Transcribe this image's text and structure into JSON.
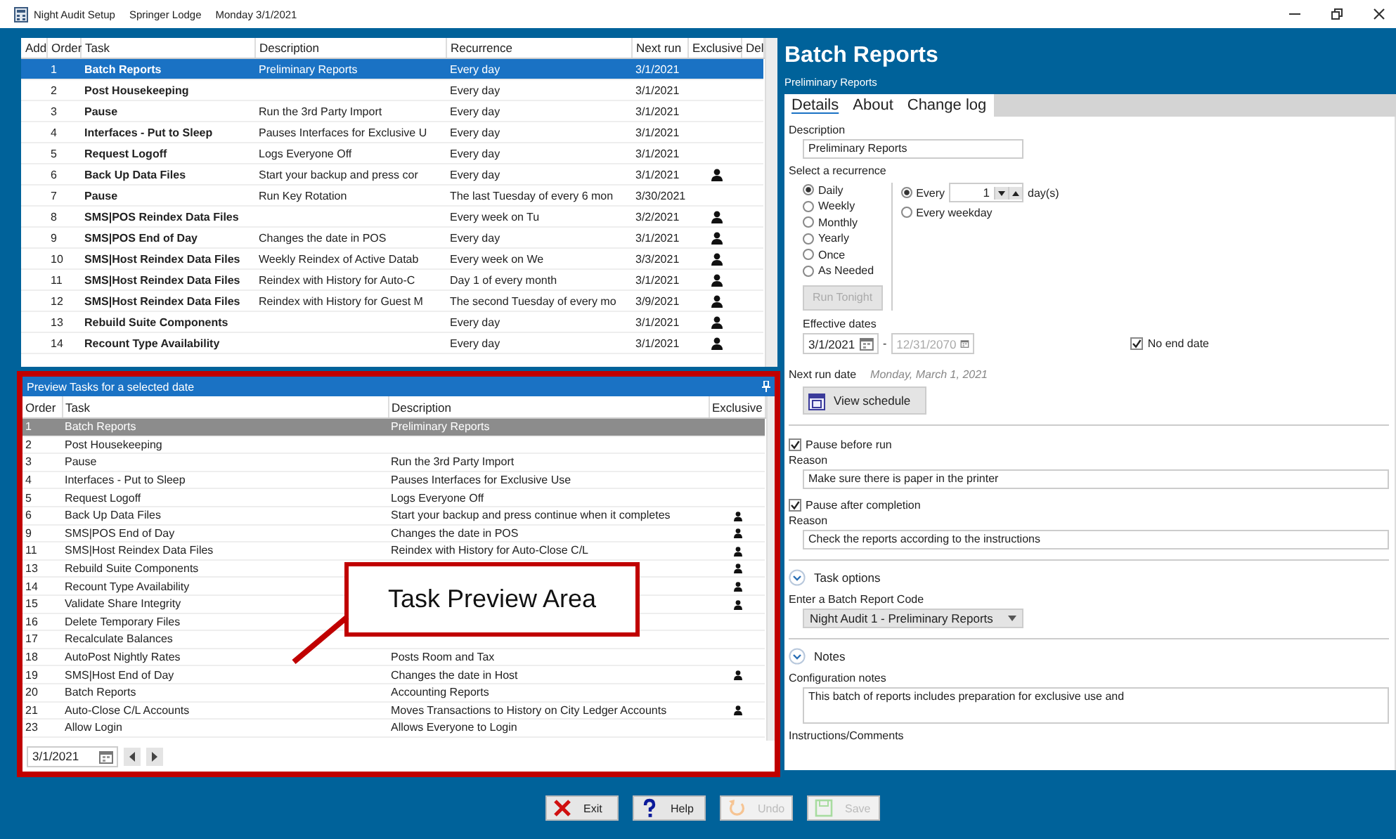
{
  "title_bar": {
    "app_name": "Night Audit Setup",
    "property": "Springer Lodge",
    "date": "Monday 3/1/2021"
  },
  "task_table": {
    "columns": [
      "Add",
      "Order",
      "Task",
      "Description",
      "Recurrence",
      "Next run",
      "Exclusive",
      "Del"
    ],
    "rows": [
      {
        "order": "1",
        "task": "Batch Reports",
        "description": "Preliminary Reports",
        "recurrence": "Every day",
        "next_run": "3/1/2021",
        "exclusive": false,
        "selected": true
      },
      {
        "order": "2",
        "task": "Post Housekeeping",
        "description": "",
        "recurrence": "Every day",
        "next_run": "3/1/2021",
        "exclusive": false,
        "selected": false
      },
      {
        "order": "3",
        "task": "Pause",
        "description": "Run the 3rd Party Import",
        "recurrence": "Every day",
        "next_run": "3/1/2021",
        "exclusive": false,
        "selected": false
      },
      {
        "order": "4",
        "task": "Interfaces - Put to Sleep",
        "description": "Pauses Interfaces for Exclusive U",
        "recurrence": "Every day",
        "next_run": "3/1/2021",
        "exclusive": false,
        "selected": false
      },
      {
        "order": "5",
        "task": "Request Logoff",
        "description": "Logs Everyone Off",
        "recurrence": "Every day",
        "next_run": "3/1/2021",
        "exclusive": false,
        "selected": false
      },
      {
        "order": "6",
        "task": "Back Up Data Files",
        "description": "Start your backup and press cor",
        "recurrence": "Every day",
        "next_run": "3/1/2021",
        "exclusive": true,
        "selected": false
      },
      {
        "order": "7",
        "task": "Pause",
        "description": "Run Key Rotation",
        "recurrence": "The last Tuesday of every 6 mon",
        "next_run": "3/30/2021",
        "exclusive": false,
        "selected": false
      },
      {
        "order": "8",
        "task": "SMS|POS Reindex Data Files",
        "description": "",
        "recurrence": "Every week on Tu",
        "next_run": "3/2/2021",
        "exclusive": true,
        "selected": false
      },
      {
        "order": "9",
        "task": "SMS|POS End of Day",
        "description": "Changes the date in POS",
        "recurrence": "Every day",
        "next_run": "3/1/2021",
        "exclusive": true,
        "selected": false
      },
      {
        "order": "10",
        "task": "SMS|Host Reindex Data Files",
        "description": "Weekly Reindex of Active Datab",
        "recurrence": "Every week on We",
        "next_run": "3/3/2021",
        "exclusive": true,
        "selected": false
      },
      {
        "order": "11",
        "task": "SMS|Host Reindex Data Files",
        "description": "Reindex with History for Auto-C",
        "recurrence": "Day 1 of every month",
        "next_run": "3/1/2021",
        "exclusive": true,
        "selected": false
      },
      {
        "order": "12",
        "task": "SMS|Host Reindex Data Files",
        "description": "Reindex with History for Guest M",
        "recurrence": "The second Tuesday of every mo",
        "next_run": "3/9/2021",
        "exclusive": true,
        "selected": false
      },
      {
        "order": "13",
        "task": "Rebuild Suite Components",
        "description": "",
        "recurrence": "Every day",
        "next_run": "3/1/2021",
        "exclusive": true,
        "selected": false
      },
      {
        "order": "14",
        "task": "Recount Type Availability",
        "description": "",
        "recurrence": "Every day",
        "next_run": "3/1/2021",
        "exclusive": true,
        "selected": false
      }
    ]
  },
  "preview": {
    "title": "Preview Tasks for a selected date",
    "columns": [
      "Order",
      "Task",
      "Description",
      "Exclusive"
    ],
    "rows": [
      {
        "order": "1",
        "task": "Batch Reports",
        "description": "Preliminary Reports",
        "exclusive": false,
        "selected": true
      },
      {
        "order": "2",
        "task": "Post Housekeeping",
        "description": "",
        "exclusive": false,
        "selected": false
      },
      {
        "order": "3",
        "task": "Pause",
        "description": "Run the 3rd Party Import",
        "exclusive": false,
        "selected": false
      },
      {
        "order": "4",
        "task": "Interfaces - Put to Sleep",
        "description": "Pauses Interfaces for Exclusive Use",
        "exclusive": false,
        "selected": false
      },
      {
        "order": "5",
        "task": "Request Logoff",
        "description": "Logs Everyone Off",
        "exclusive": false,
        "selected": false
      },
      {
        "order": "6",
        "task": "Back Up Data Files",
        "description": "Start your backup and press continue when it completes",
        "exclusive": true,
        "selected": false
      },
      {
        "order": "9",
        "task": "SMS|POS End of Day",
        "description": "Changes the date in POS",
        "exclusive": true,
        "selected": false
      },
      {
        "order": "11",
        "task": "SMS|Host Reindex Data Files",
        "description": "Reindex with History for Auto-Close C/L",
        "exclusive": true,
        "selected": false
      },
      {
        "order": "13",
        "task": "Rebuild Suite Components",
        "description": "",
        "exclusive": true,
        "selected": false
      },
      {
        "order": "14",
        "task": "Recount Type Availability",
        "description": "",
        "exclusive": true,
        "selected": false
      },
      {
        "order": "15",
        "task": "Validate Share Integrity",
        "description": "",
        "exclusive": true,
        "selected": false
      },
      {
        "order": "16",
        "task": "Delete Temporary Files",
        "description": "",
        "exclusive": false,
        "selected": false
      },
      {
        "order": "17",
        "task": "Recalculate Balances",
        "description": "",
        "exclusive": false,
        "selected": false
      },
      {
        "order": "18",
        "task": "AutoPost Nightly Rates",
        "description": "Posts Room and Tax",
        "exclusive": false,
        "selected": false
      },
      {
        "order": "19",
        "task": "SMS|Host End of Day",
        "description": "Changes the date in Host",
        "exclusive": true,
        "selected": false
      },
      {
        "order": "20",
        "task": "Batch Reports",
        "description": "Accounting Reports",
        "exclusive": false,
        "selected": false
      },
      {
        "order": "21",
        "task": "Auto-Close C/L Accounts",
        "description": "Moves Transactions to History on City Ledger Accounts",
        "exclusive": true,
        "selected": false
      },
      {
        "order": "23",
        "task": "Allow Login",
        "description": "Allows Everyone to Login",
        "exclusive": false,
        "selected": false
      }
    ],
    "date": "3/1/2021"
  },
  "annotation": {
    "text": "Task Preview Area"
  },
  "detail": {
    "title": "Batch Reports",
    "subtitle": "Preliminary Reports",
    "tabs": [
      {
        "label": "Details",
        "selected": true
      },
      {
        "label": "About",
        "selected": false
      },
      {
        "label": "Change log",
        "selected": false
      }
    ],
    "description_label": "Description",
    "description_value": "Preliminary Reports",
    "recurrence_label": "Select a recurrence",
    "recurrence_options": [
      {
        "label": "Daily",
        "selected": true
      },
      {
        "label": "Weekly",
        "selected": false
      },
      {
        "label": "Monthly",
        "selected": false
      },
      {
        "label": "Yearly",
        "selected": false
      },
      {
        "label": "Once",
        "selected": false
      },
      {
        "label": "As Needed",
        "selected": false
      }
    ],
    "run_tonight": {
      "label": "Run Tonight",
      "disabled": true
    },
    "every": {
      "label": "Every",
      "selected": true,
      "value": "1",
      "unit": "day(s)"
    },
    "every_weekday": {
      "label": "Every weekday",
      "selected": false
    },
    "effective_label": "Effective dates",
    "start_date": "3/1/2021",
    "date_separator": "-",
    "end_date": {
      "value": "12/31/2070",
      "disabled": true
    },
    "no_end_date": {
      "label": "No end date",
      "checked": true
    },
    "next_run_label": "Next run date",
    "next_run_value": "Monday, March 1, 2021",
    "view_schedule": "View schedule",
    "pause_before": {
      "label": "Pause before run",
      "checked": true,
      "reason_label": "Reason",
      "reason": "Make sure there is paper in the printer"
    },
    "pause_after": {
      "label": "Pause after completion",
      "checked": true,
      "reason_label": "Reason",
      "reason": "Check the reports according to the instructions"
    },
    "task_options": {
      "label": "Task options",
      "expanded": true,
      "field_label": "Enter a Batch Report Code",
      "value": "Night Audit 1 - Preliminary Reports"
    },
    "notes": {
      "label": "Notes",
      "expanded": true,
      "config_label": "Configuration notes",
      "config_value": "This batch of reports includes preparation for exclusive use and",
      "instructions_label": "Instructions/Comments"
    }
  },
  "buttons": [
    {
      "label": "Exit",
      "kind": "exit",
      "disabled": false
    },
    {
      "label": "Help",
      "kind": "help",
      "disabled": false
    },
    {
      "label": "Undo",
      "kind": "undo",
      "disabled": true
    },
    {
      "label": "Save",
      "kind": "save",
      "disabled": true
    }
  ]
}
